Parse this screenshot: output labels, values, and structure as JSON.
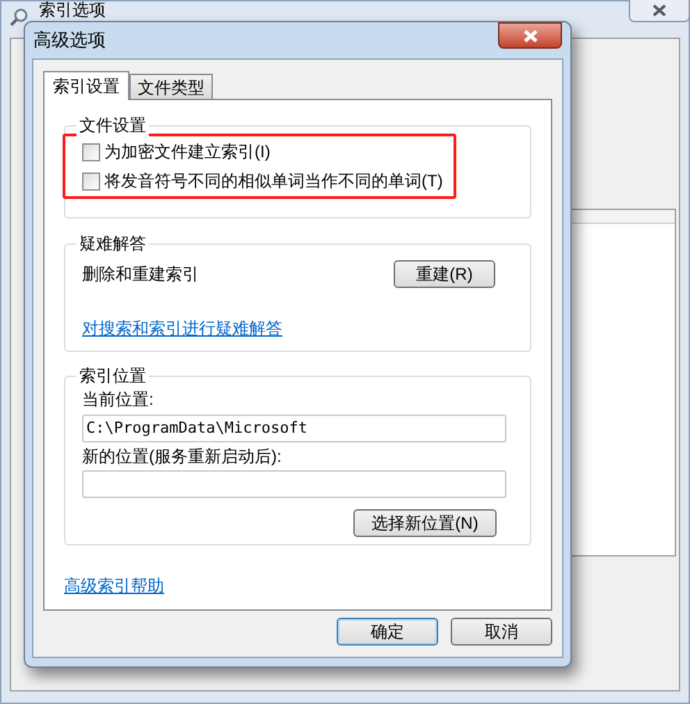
{
  "background_window": {
    "title": "索引选项"
  },
  "dialog": {
    "title": "高级选项"
  },
  "tabs": [
    {
      "label": "索引设置",
      "selected": true
    },
    {
      "label": "文件类型",
      "selected": false
    }
  ],
  "file_settings": {
    "title": "文件设置",
    "highlighted": true,
    "options": [
      {
        "label": "为加密文件建立索引(I)",
        "checked": false
      },
      {
        "label": "将发音符号不同的相似单词当作不同的单词(T)",
        "checked": false
      }
    ]
  },
  "troubleshooting": {
    "title": "疑难解答",
    "text": "删除和重建索引",
    "button": "重建(R)",
    "link": "对搜索和索引进行疑难解答"
  },
  "index_location": {
    "title": "索引位置",
    "current_label": "当前位置:",
    "current_value": "C:\\ProgramData\\Microsoft",
    "new_label": "新的位置(服务重新启动后):",
    "button": "选择新位置(N)"
  },
  "help_link": "高级索引帮助",
  "buttons": [
    {
      "label": "确定",
      "kind": "default"
    },
    {
      "label": "取消",
      "kind": "normal"
    }
  ]
}
